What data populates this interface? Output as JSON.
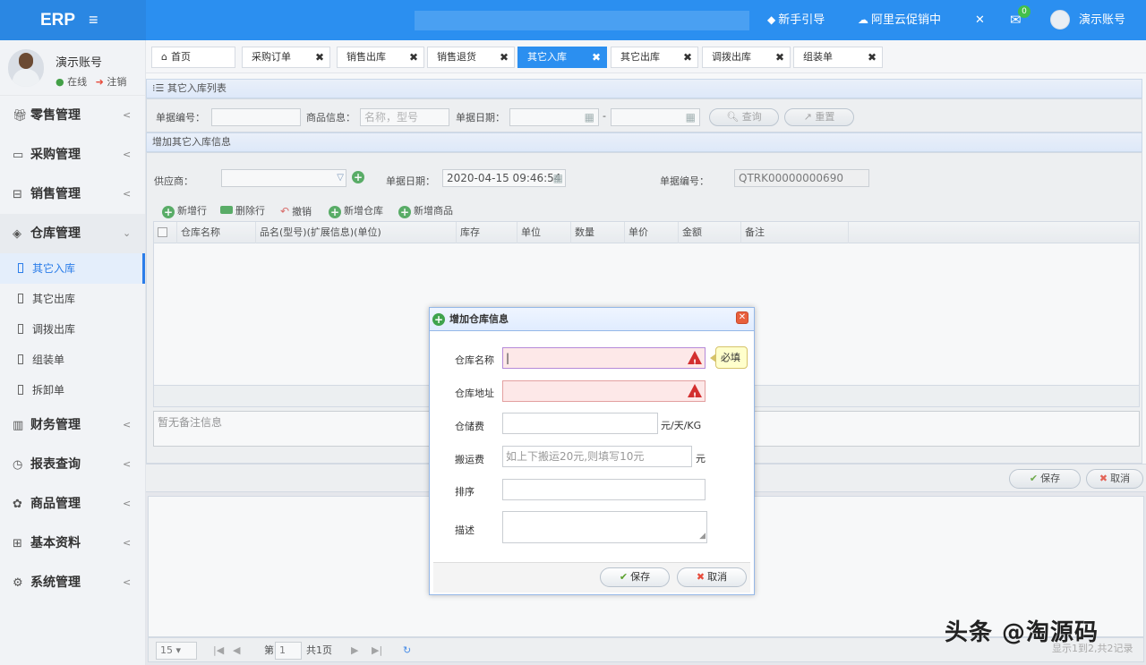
{
  "header": {
    "brand": "ERP",
    "menu_icon": "hamburger-icon",
    "guide": "新手引导",
    "promo": "阿里云促销中",
    "mail_badge": "0",
    "account": "演示账号",
    "accent": "#2b8ff0"
  },
  "user": {
    "name": "演示账号",
    "status": "在线",
    "logout": "注销"
  },
  "sidebar": {
    "items": [
      {
        "label": "零售管理",
        "icon": "gift-icon"
      },
      {
        "label": "采购管理",
        "icon": "screen-icon"
      },
      {
        "label": "销售管理",
        "icon": "building-icon"
      },
      {
        "label": "仓库管理",
        "icon": "layers-icon"
      },
      {
        "label": "财务管理",
        "icon": "book-icon"
      },
      {
        "label": "报表查询",
        "icon": "clock-icon"
      },
      {
        "label": "商品管理",
        "icon": "flower-icon"
      },
      {
        "label": "基本资料",
        "icon": "grid-icon"
      },
      {
        "label": "系统管理",
        "icon": "gear-icon"
      }
    ],
    "subitems": [
      "其它入库",
      "其它出库",
      "调拨出库",
      "组装单",
      "拆卸单"
    ]
  },
  "tabs": [
    "首页",
    "采购订单",
    "销售出库",
    "销售退货",
    "其它入库",
    "其它出库",
    "调拨出库",
    "组装单"
  ],
  "list_panel": {
    "title": "其它入库列表",
    "search": {
      "doc_no_label": "单据编号：",
      "goods_label": "商品信息：",
      "goods_placeholder": "名称，型号",
      "date_label": "单据日期：",
      "date_sep": "-",
      "query": "查询",
      "reset": "重置"
    }
  },
  "form_panel": {
    "title": "增加其它入库信息",
    "supplier_label": "供应商：",
    "date_label": "单据日期：",
    "date_value": "2020-04-15 09:46:54",
    "doc_no_label": "单据编号：",
    "doc_no_value": "QTRK00000000690",
    "toolbar": [
      "新增行",
      "删除行",
      "撤销",
      "新增仓库",
      "新增商品"
    ],
    "columns": [
      "仓库名称",
      "品名(型号)(扩展信息)(单位)",
      "库存",
      "单位",
      "数量",
      "单价",
      "金额",
      "备注"
    ],
    "remark_placeholder": "暂无备注信息",
    "save": "保存",
    "cancel": "取消"
  },
  "pager": {
    "size": "15",
    "page_prefix": "第",
    "page": "1",
    "total": "共1页",
    "count": "显示1到2,共2记录"
  },
  "dialog": {
    "title": "增加仓库信息",
    "fields": [
      {
        "label": "仓库名称",
        "value": "",
        "required": true
      },
      {
        "label": "仓库地址",
        "value": "",
        "required": true
      },
      {
        "label": "仓储费",
        "value": "",
        "unit": "元/天/KG"
      },
      {
        "label": "搬运费",
        "placeholder": "如上下搬运20元,则填写10元",
        "unit": "元"
      },
      {
        "label": "排序",
        "value": ""
      },
      {
        "label": "描述",
        "value": ""
      }
    ],
    "tooltip": "必填",
    "save": "保存",
    "cancel": "取消"
  },
  "watermark": "头条 @淘源码"
}
